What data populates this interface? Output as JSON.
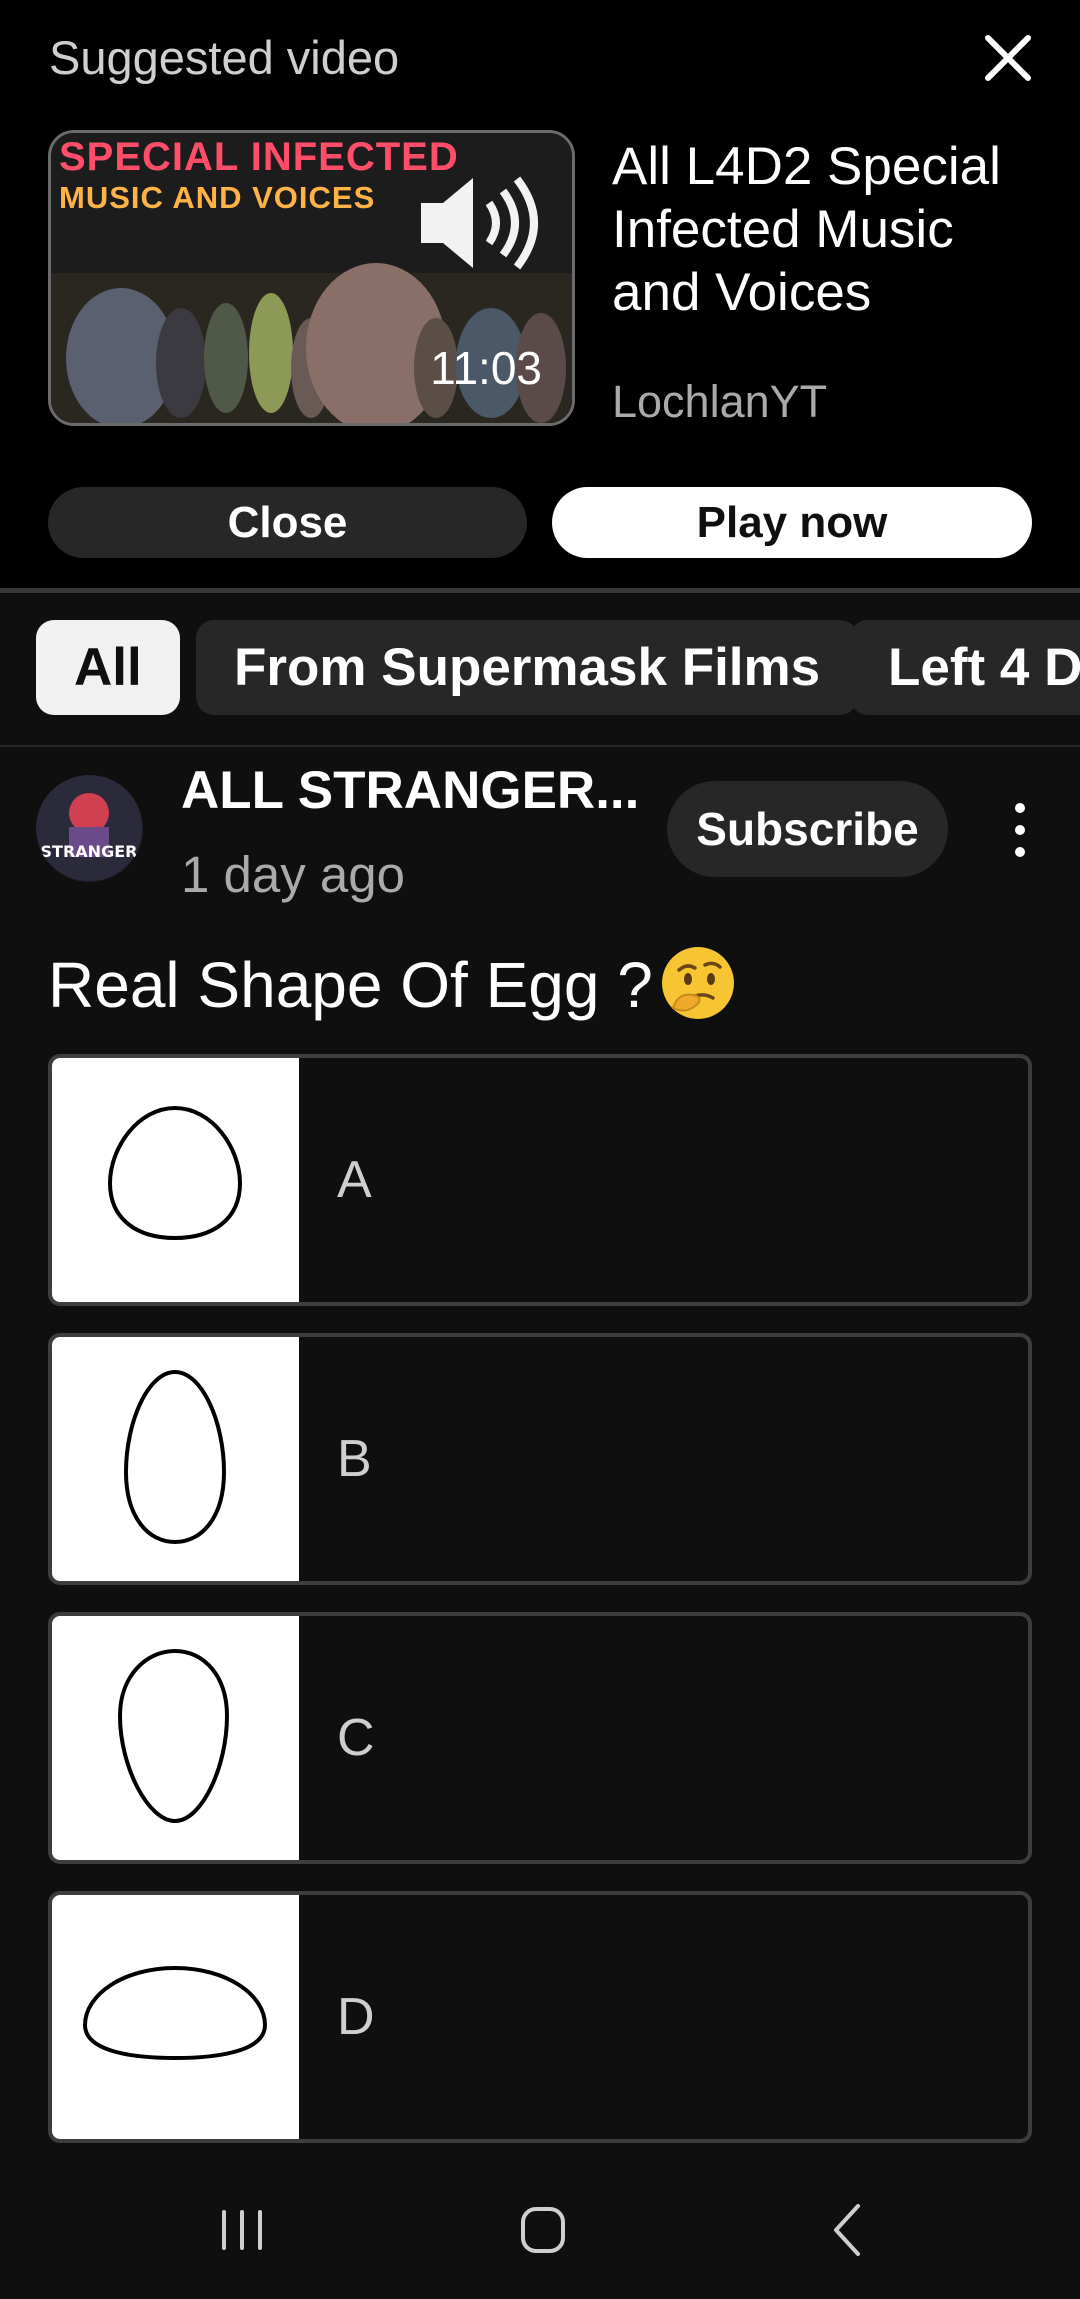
{
  "suggested": {
    "heading": "Suggested video",
    "thumbnail_line1": "SPECIAL INFECTED",
    "thumbnail_line2": "MUSIC AND VOICES",
    "duration": "11:03",
    "title": "All L4D2 Special Infected Music and Voices",
    "channel": "LochlanYT",
    "close_label": "Close",
    "play_label": "Play now"
  },
  "chips": [
    "All",
    "From Supermask Films",
    "Left 4 De"
  ],
  "post": {
    "author": "ALL STRANGER...",
    "avatar_text": "STRANGER",
    "time": "1 day ago",
    "subscribe_label": "Subscribe",
    "title": "Real Shape Of Egg ?",
    "options": [
      {
        "label": "A",
        "shape": "round-egg"
      },
      {
        "label": "B",
        "shape": "tall-egg"
      },
      {
        "label": "C",
        "shape": "inverted-egg"
      },
      {
        "label": "D",
        "shape": "flat-dome"
      }
    ]
  },
  "colors": {
    "background": "#0f0f0f",
    "panel": "#000000",
    "chip_active": "#f1f1f1",
    "chip": "#272727",
    "thumb_red": "#ff4d6a",
    "thumb_orange": "#ffb347"
  }
}
